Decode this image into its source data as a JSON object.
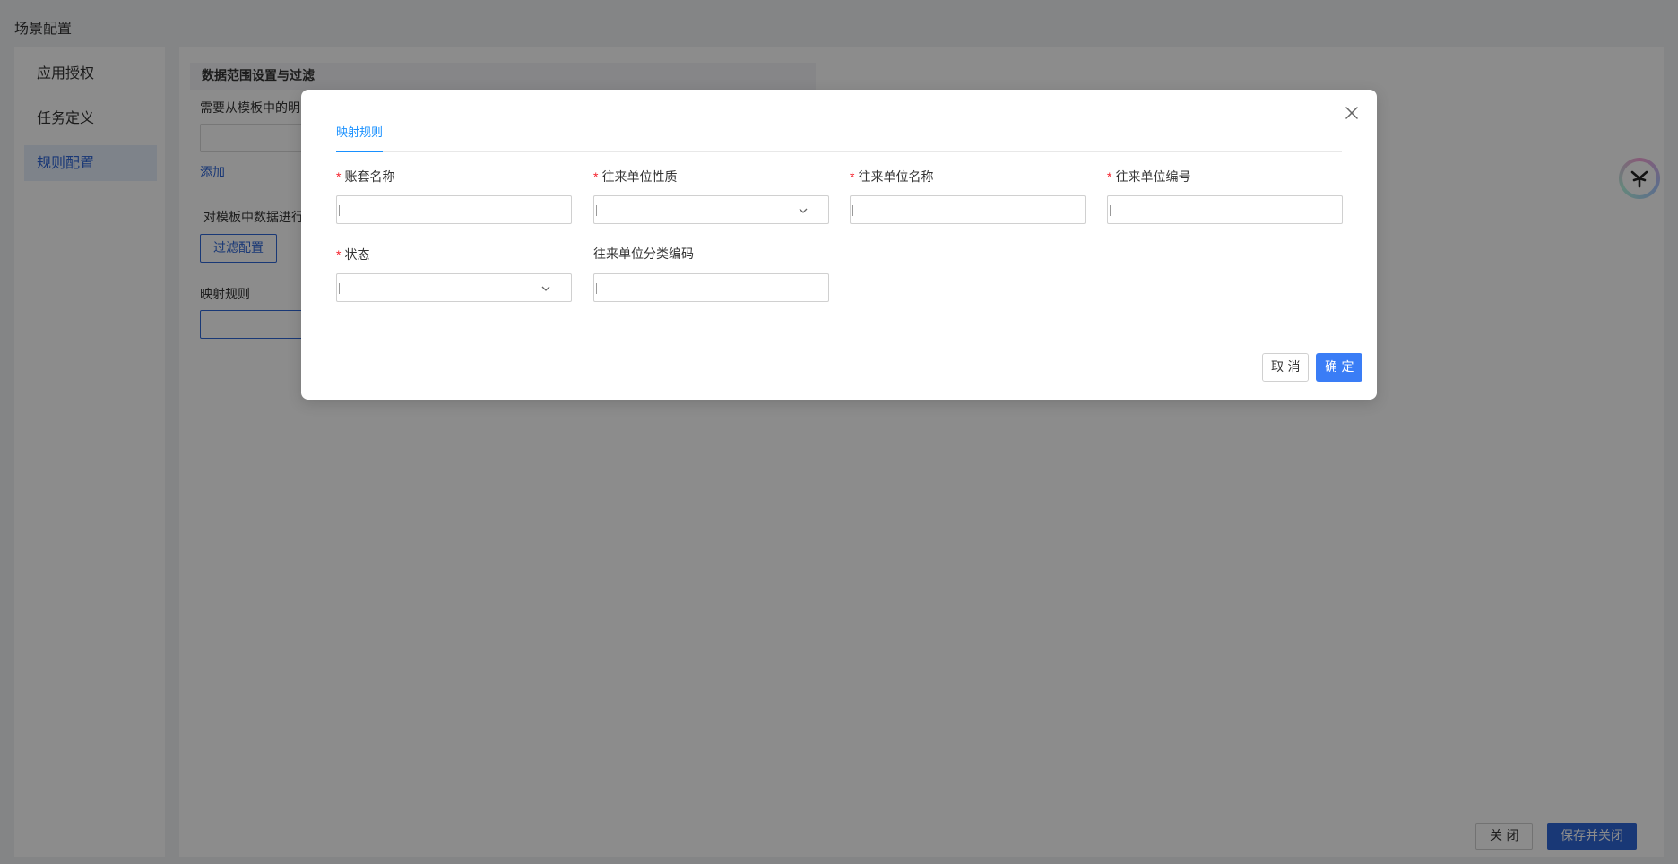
{
  "page": {
    "title": "场景配置"
  },
  "sidebar": {
    "items": [
      {
        "label": "应用授权",
        "active": false
      },
      {
        "label": "任务定义",
        "active": false
      },
      {
        "label": "规则配置",
        "active": true
      }
    ]
  },
  "main": {
    "section_title": "数据范围设置与过滤",
    "detail_label": "需要从模板中的明",
    "add_link": "添加",
    "filter_label": "对模板中数据进行",
    "filter_button": "过滤配置",
    "mapping_label": "映射规则",
    "close_button": "关 闭",
    "save_close_button": "保存并关闭"
  },
  "modal": {
    "tab_label": "映射规则",
    "fields": [
      {
        "label": "账套名称",
        "required": true,
        "type": "input",
        "value": ""
      },
      {
        "label": "往来单位性质",
        "required": true,
        "type": "select",
        "value": ""
      },
      {
        "label": "往来单位名称",
        "required": true,
        "type": "input",
        "value": ""
      },
      {
        "label": "往来单位编号",
        "required": true,
        "type": "input",
        "value": ""
      },
      {
        "label": "状态",
        "required": true,
        "type": "select",
        "value": ""
      },
      {
        "label": "往来单位分类编码",
        "required": false,
        "type": "input",
        "value": ""
      }
    ],
    "required_mark": "*",
    "cancel_button": "取 消",
    "ok_button": "确 定"
  },
  "icons": {
    "close": "close-icon",
    "chevron": "chevron-down-icon",
    "assistant": "assistant-icon"
  },
  "colors": {
    "primary": "#2f66d8",
    "tab_active": "#1890ff",
    "ok_button": "#3a7df6",
    "required": "#f5222d",
    "overlay": "rgba(0,0,0,0.45)"
  }
}
